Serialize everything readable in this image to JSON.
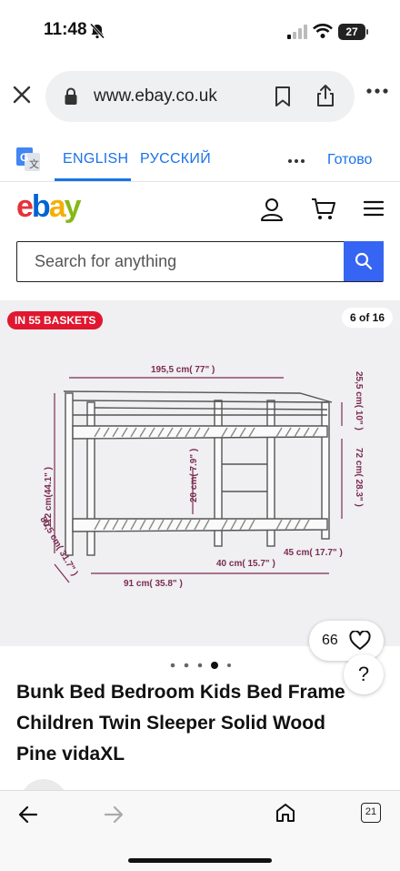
{
  "status_bar": {
    "time": "11:48",
    "battery": "27"
  },
  "browser": {
    "url": "www.ebay.co.uk"
  },
  "translate": {
    "lang_english": "ENGLISH",
    "lang_russian": "РУССКИЙ",
    "done": "Готово"
  },
  "ebay": {
    "logo_letters": [
      "e",
      "b",
      "a",
      "y"
    ],
    "logo_colors": [
      "#e53238",
      "#0064d2",
      "#f5af02",
      "#86b817"
    ],
    "search_placeholder": "Search for anything",
    "accent": "#3665f3"
  },
  "listing": {
    "basket_badge": "IN 55 BASKETS",
    "image_counter": "6 of 16",
    "like_count": "66",
    "help": "?",
    "title_lines": [
      "Bunk Bed Bedroom Kids Bed Frame",
      "Children Twin Sleeper Solid Wood",
      "Pine vidaXL"
    ],
    "dimensions": {
      "width_top": "195,5 cm( 77\" )",
      "height_total": "112 cm(44.1\" )",
      "upper_rail": "25,5 cm( 10\" )",
      "upper_height": "72 cm( 28.3\" )",
      "ladder": "20 cm( 7.9\" )",
      "depth": "80,5 cm( 31.7\" )",
      "len_a": "91 cm( 35.8\" )",
      "len_b": "40 cm( 15.7\" )",
      "len_c": "45 cm( 17.7\" )"
    },
    "carousel_total": 5,
    "carousel_active": 3
  },
  "toolbar": {
    "tab_count": "21"
  },
  "icons": {
    "close": "close-icon",
    "lock": "lock-icon",
    "bookmark": "bookmark-icon",
    "share": "share-icon",
    "user": "user-icon",
    "cart": "cart-icon",
    "menu": "hamburger-icon",
    "search": "search-icon",
    "heart": "heart-icon",
    "back": "back-arrow-icon",
    "forward": "forward-arrow-icon",
    "home": "home-icon"
  }
}
